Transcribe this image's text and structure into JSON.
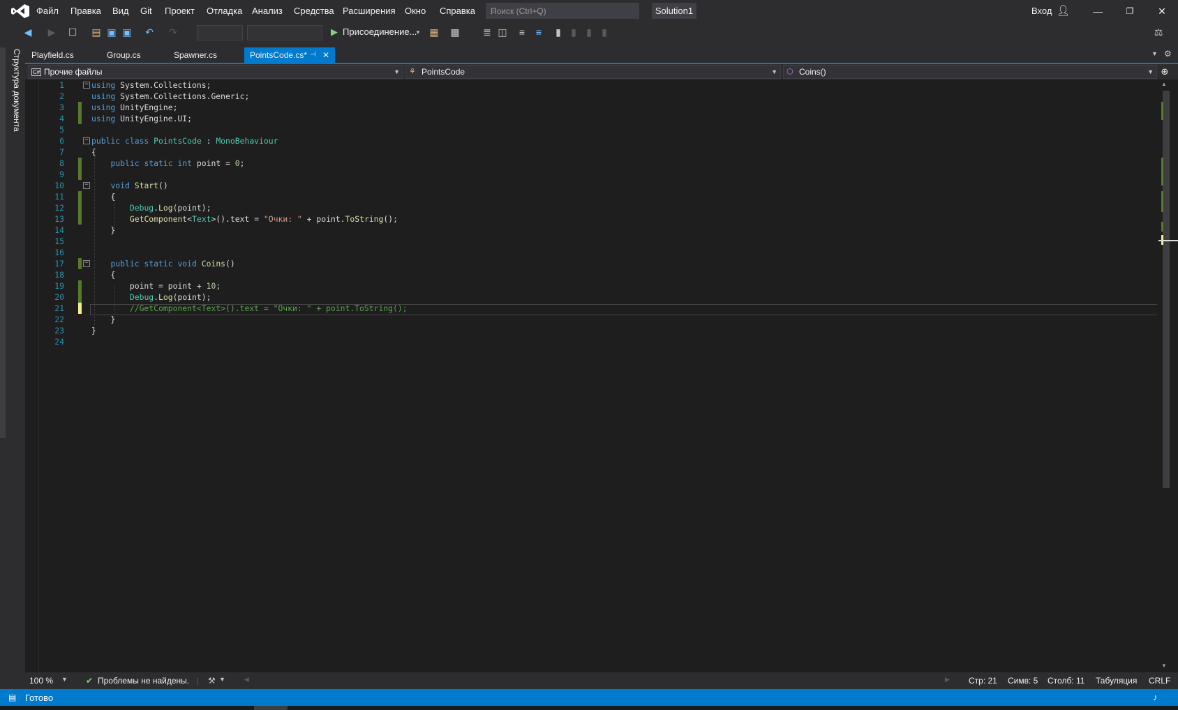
{
  "menu": [
    "Файл",
    "Правка",
    "Вид",
    "Git",
    "Проект",
    "Отладка",
    "Анализ",
    "Средства",
    "Расширения",
    "Окно",
    "Справка"
  ],
  "search": {
    "placeholder": "Поиск (Ctrl+Q)"
  },
  "solution": "Solution1",
  "account": {
    "signin": "Вход"
  },
  "toolbar": {
    "attach_label": "Присоединение..."
  },
  "doc_outline": "Структура документа",
  "tabs": [
    {
      "label": "Playfield.cs",
      "active": false
    },
    {
      "label": "Group.cs",
      "active": false
    },
    {
      "label": "Spawner.cs",
      "active": false
    },
    {
      "label": "PointsCode.cs*",
      "active": true
    }
  ],
  "nav": {
    "project": "Прочие файлы",
    "type": "PointsCode",
    "member": "Coins()"
  },
  "code": {
    "line_numbers": [
      "1",
      "2",
      "3",
      "4",
      "5",
      "6",
      "7",
      "8",
      "9",
      "10",
      "11",
      "12",
      "13",
      "14",
      "15",
      "16",
      "17",
      "18",
      "19",
      "20",
      "21",
      "22",
      "23",
      "24"
    ],
    "current_line": 21
  },
  "infobar": {
    "zoom": "100 %",
    "problems": "Проблемы не найдены.",
    "line": "Стр: 21",
    "char": "Симв: 5",
    "col": "Столб: 11",
    "indent": "Табуляция",
    "eol": "CRLF"
  },
  "status": {
    "text": "Готово"
  },
  "colors": {
    "accent": "#007acc",
    "change_marker": "#57792e",
    "current_change": "#efef91"
  }
}
